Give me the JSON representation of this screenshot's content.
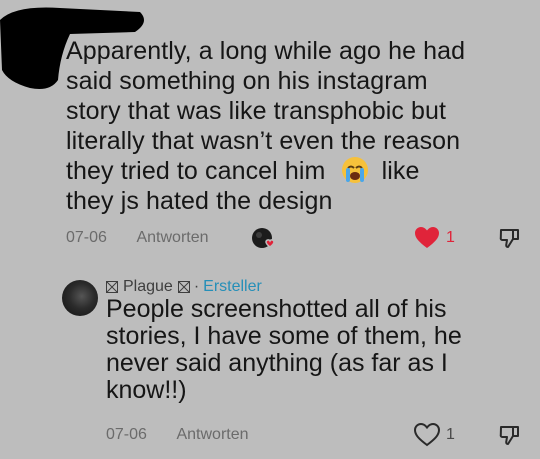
{
  "comment": {
    "lines": [
      "Apparently, a long while ago he had",
      "said something on his instagram",
      "story that was like transphobic but",
      "literally that wasn’t even the reason",
      "they tried to cancel him",
      "like",
      "they js hated the design"
    ],
    "emoji": "loudly-crying-face",
    "date": "07-06",
    "reply_label": "Antworten",
    "like_count": "1",
    "liked": true,
    "like_color": "#e0243a"
  },
  "reply": {
    "author": "Plague",
    "separator": "·",
    "author_badge": "Ersteller",
    "badge_color": "#258fb8",
    "lines": [
      "People screenshotted all of his",
      "stories, I have some of them, he",
      "never said anything (as far as I",
      "know!!)"
    ],
    "date": "07-06",
    "reply_label": "Antworten",
    "like_count": "1",
    "liked": false
  }
}
